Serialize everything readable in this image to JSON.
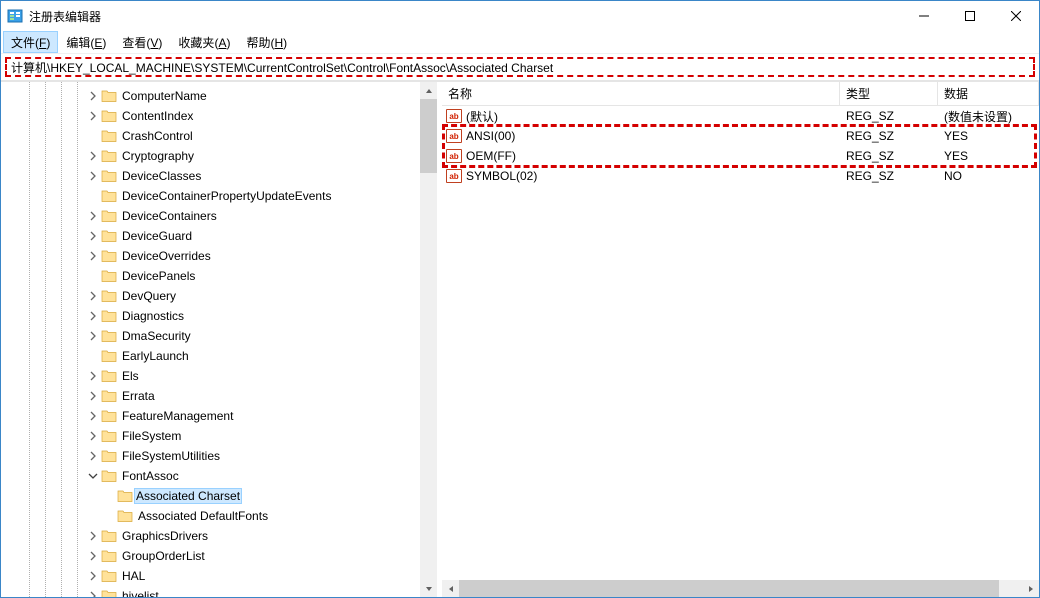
{
  "window": {
    "title": "注册表编辑器"
  },
  "menus": {
    "file": {
      "label": "文件",
      "key": "F",
      "active": true
    },
    "edit": {
      "label": "编辑",
      "key": "E"
    },
    "view": {
      "label": "查看",
      "key": "V"
    },
    "fav": {
      "label": "收藏夹",
      "key": "A"
    },
    "help": {
      "label": "帮助",
      "key": "H"
    }
  },
  "address": "计算机\\HKEY_LOCAL_MACHINE\\SYSTEM\\CurrentControlSet\\Control\\FontAssoc\\Associated Charset",
  "list_headers": {
    "name": "名称",
    "type": "类型",
    "data": "数据"
  },
  "values": [
    {
      "name": "(默认)",
      "type": "REG_SZ",
      "data": "(数值未设置)",
      "hl": false
    },
    {
      "name": "ANSI(00)",
      "type": "REG_SZ",
      "data": "YES",
      "hl": true
    },
    {
      "name": "OEM(FF)",
      "type": "REG_SZ",
      "data": "YES",
      "hl": true
    },
    {
      "name": "SYMBOL(02)",
      "type": "REG_SZ",
      "data": "NO",
      "hl": false
    }
  ],
  "tree": [
    {
      "indent": 5,
      "tw": "closed",
      "label": "ComputerName"
    },
    {
      "indent": 5,
      "tw": "closed",
      "label": "ContentIndex"
    },
    {
      "indent": 5,
      "tw": "none",
      "label": "CrashControl"
    },
    {
      "indent": 5,
      "tw": "closed",
      "label": "Cryptography"
    },
    {
      "indent": 5,
      "tw": "closed",
      "label": "DeviceClasses"
    },
    {
      "indent": 5,
      "tw": "none",
      "label": "DeviceContainerPropertyUpdateEvents"
    },
    {
      "indent": 5,
      "tw": "closed",
      "label": "DeviceContainers"
    },
    {
      "indent": 5,
      "tw": "closed",
      "label": "DeviceGuard"
    },
    {
      "indent": 5,
      "tw": "closed",
      "label": "DeviceOverrides"
    },
    {
      "indent": 5,
      "tw": "none",
      "label": "DevicePanels"
    },
    {
      "indent": 5,
      "tw": "closed",
      "label": "DevQuery"
    },
    {
      "indent": 5,
      "tw": "closed",
      "label": "Diagnostics"
    },
    {
      "indent": 5,
      "tw": "closed",
      "label": "DmaSecurity"
    },
    {
      "indent": 5,
      "tw": "none",
      "label": "EarlyLaunch"
    },
    {
      "indent": 5,
      "tw": "closed",
      "label": "Els"
    },
    {
      "indent": 5,
      "tw": "closed",
      "label": "Errata"
    },
    {
      "indent": 5,
      "tw": "closed",
      "label": "FeatureManagement"
    },
    {
      "indent": 5,
      "tw": "closed",
      "label": "FileSystem"
    },
    {
      "indent": 5,
      "tw": "closed",
      "label": "FileSystemUtilities"
    },
    {
      "indent": 5,
      "tw": "open",
      "label": "FontAssoc"
    },
    {
      "indent": 6,
      "tw": "none",
      "label": "Associated Charset",
      "selected": true
    },
    {
      "indent": 6,
      "tw": "none",
      "label": "Associated DefaultFonts"
    },
    {
      "indent": 5,
      "tw": "closed",
      "label": "GraphicsDrivers"
    },
    {
      "indent": 5,
      "tw": "closed",
      "label": "GroupOrderList"
    },
    {
      "indent": 5,
      "tw": "closed",
      "label": "HAL"
    },
    {
      "indent": 5,
      "tw": "closed",
      "label": "hivelist"
    }
  ]
}
